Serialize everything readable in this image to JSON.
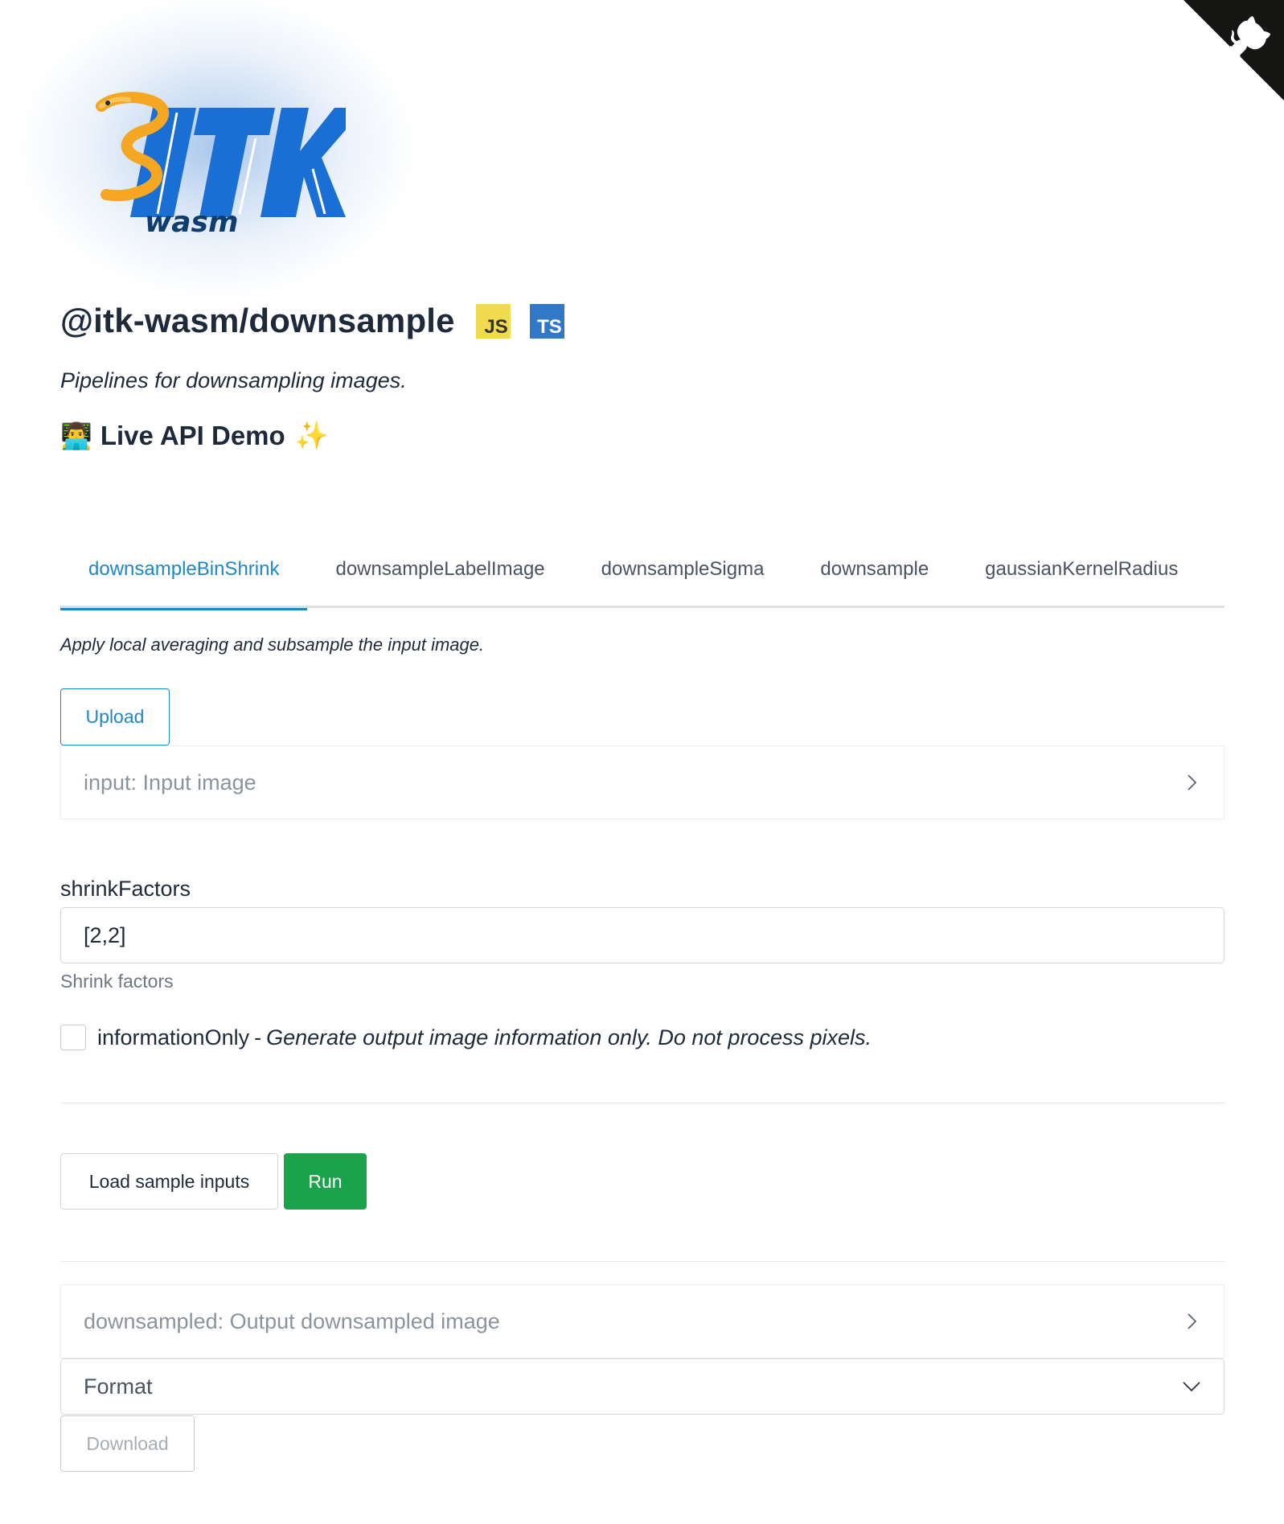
{
  "logo": {
    "text": "ITK",
    "subtext": "wasm"
  },
  "header": {
    "title": "@itk-wasm/downsample",
    "badges": [
      "JS",
      "TS"
    ],
    "subtitle": "Pipelines for downsampling images.",
    "demo_heading": "Live API Demo",
    "demo_emoji": "👨‍💻",
    "sparkle": "✨"
  },
  "tabs": [
    {
      "label": "downsampleBinShrink",
      "active": true
    },
    {
      "label": "downsampleLabelImage",
      "active": false
    },
    {
      "label": "downsampleSigma",
      "active": false
    },
    {
      "label": "downsample",
      "active": false
    },
    {
      "label": "gaussianKernelRadius",
      "active": false
    }
  ],
  "tab_content": {
    "description": "Apply local averaging and subsample the input image.",
    "upload_label": "Upload",
    "input_panel": "input: Input image",
    "shrink_factors": {
      "label": "shrinkFactors",
      "value": "[2,2]",
      "help": "Shrink factors"
    },
    "information_only": {
      "label": "informationOnly",
      "separator": "-",
      "description": "Generate output image information only. Do not process pixels.",
      "checked": false
    },
    "load_sample_label": "Load sample inputs",
    "run_label": "Run",
    "output_panel": "downsampled: Output downsampled image",
    "format_select": "Format",
    "download_label": "Download"
  },
  "colors": {
    "accent": "#1e88c7",
    "run": "#1aa34a",
    "js_badge": "#f0db4f",
    "ts_badge": "#3178c6",
    "logo_blue": "#1a6fd4",
    "logo_orange": "#f5a623"
  },
  "icons": {
    "github_corner": "github-octocat-icon",
    "panel_chevron": "chevron-right-icon",
    "select_chevron": "chevron-down-icon"
  }
}
